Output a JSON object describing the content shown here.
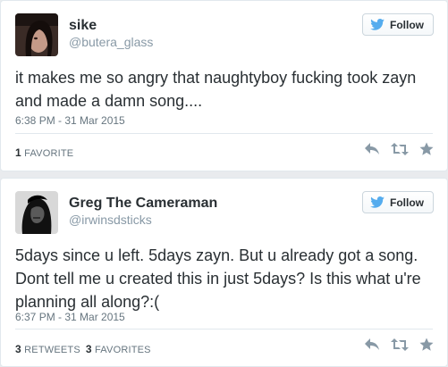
{
  "tweets": [
    {
      "display_name": "sike",
      "handle": "@butera_glass",
      "follow_label": "Follow",
      "text": "it makes me so angry that naughtyboy fucking took zayn and made a damn song....",
      "timestamp": "6:38 PM - 31 Mar 2015",
      "stats": [
        {
          "count": "1",
          "label": "FAVORITE"
        }
      ]
    },
    {
      "display_name": "Greg The Cameraman",
      "handle": "@irwinsdsticks",
      "follow_label": "Follow",
      "text": "5days since u left. 5days zayn. But u already got a song. Dont tell me u created this in just 5days? Is this what u're planning all along?:(",
      "timestamp": "6:37 PM - 31 Mar 2015",
      "stats": [
        {
          "count": "3",
          "label": "RETWEETS"
        },
        {
          "count": "3",
          "label": "FAVORITES"
        }
      ]
    }
  ],
  "icons": {
    "follow": "twitter-bird-icon",
    "reply": "reply-icon",
    "retweet": "retweet-icon",
    "favorite": "star-icon"
  },
  "colors": {
    "twitter_blue": "#55acee",
    "text": "#292f33",
    "muted": "#8899a6",
    "action_gray": "#8899a6"
  }
}
